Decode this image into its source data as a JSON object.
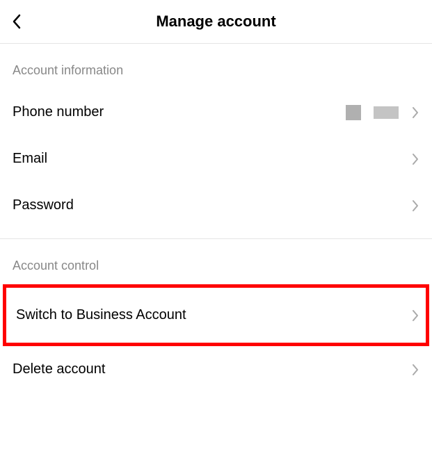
{
  "header": {
    "title": "Manage account"
  },
  "sections": {
    "account_information": {
      "title": "Account information",
      "items": {
        "phone": "Phone number",
        "email": "Email",
        "password": "Password"
      }
    },
    "account_control": {
      "title": "Account control",
      "items": {
        "switch_business": "Switch to Business Account",
        "delete": "Delete account"
      }
    }
  }
}
